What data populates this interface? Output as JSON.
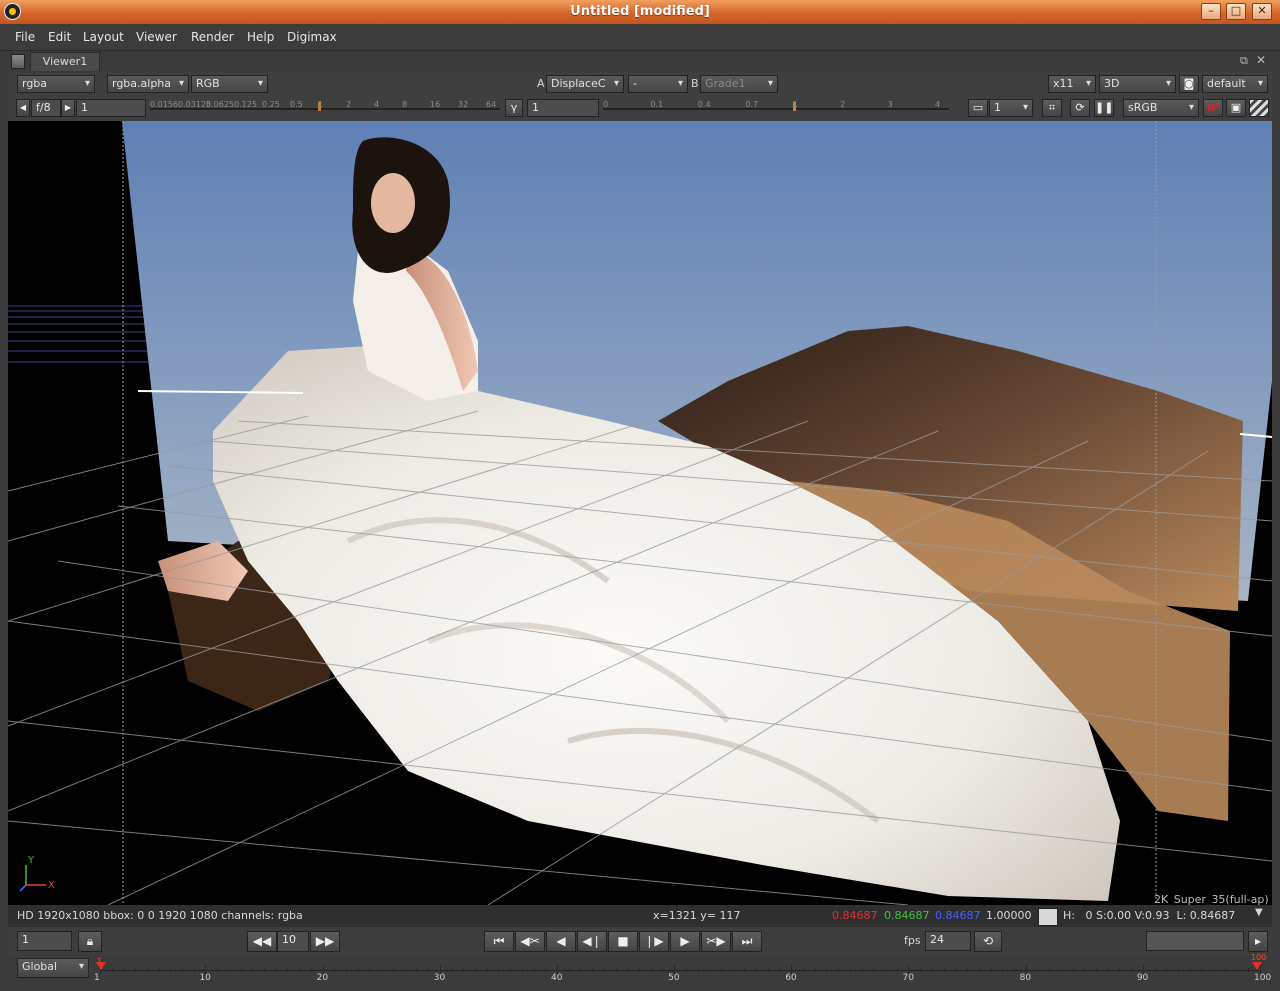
{
  "window": {
    "title": "Untitled [modified]",
    "minimize": "–",
    "maximize": "□",
    "close": "✕"
  },
  "menu": [
    "File",
    "Edit",
    "Layout",
    "Viewer",
    "Render",
    "Help",
    "Digimax"
  ],
  "tabs": {
    "viewer": "Viewer1"
  },
  "toolbar1": {
    "channels": "rgba",
    "alpha": "rgba.alpha",
    "display": "RGB",
    "a_label": "A",
    "a_input": "DisplaceC",
    "operation": "-",
    "b_label": "B",
    "b_input": "Grade1",
    "zoom": "x11",
    "view_mode": "3D",
    "camera": "default"
  },
  "toolbar2": {
    "fstop": "f/8",
    "gain_value": "1",
    "gain_ticks": [
      "0.0156",
      "0.03125",
      "0.0625",
      "0.125",
      "0.25",
      "0.5",
      "1",
      "2",
      "4",
      "8",
      "16",
      "32",
      "64"
    ],
    "gamma_label": "γ",
    "gamma_value": "1",
    "gamma_ticks": [
      "0",
      "0.1",
      "0.4",
      "0.7",
      "1",
      "2",
      "3",
      "4"
    ],
    "proxy": "1",
    "colorspace": "sRGB",
    "ip": "IP"
  },
  "viewport": {
    "format_label": "2K_Super_35(full-ap)",
    "axis_x": "X",
    "axis_y": "Y"
  },
  "infobar": {
    "info": "HD 1920x1080 bbox: 0 0 1920 1080 channels: rgba",
    "coords": "x=1321 y= 117",
    "r": "0.84687",
    "g": "0.84687",
    "b": "0.84687",
    "a": "1.00000",
    "hsv": "H:   0 S:0.00 V:0.93  L: 0.84687",
    "colors": {
      "r": "#e03030",
      "g": "#40c040",
      "b": "#4060ff"
    }
  },
  "transport": {
    "frame": "1",
    "skip": "10",
    "fps_label": "fps",
    "fps": "24"
  },
  "timeline": {
    "scope": "Global",
    "ticks": [
      "1",
      "10",
      "20",
      "30",
      "40",
      "50",
      "60",
      "70",
      "80",
      "90",
      "100"
    ],
    "start_marker": "1",
    "end_marker": "100"
  }
}
